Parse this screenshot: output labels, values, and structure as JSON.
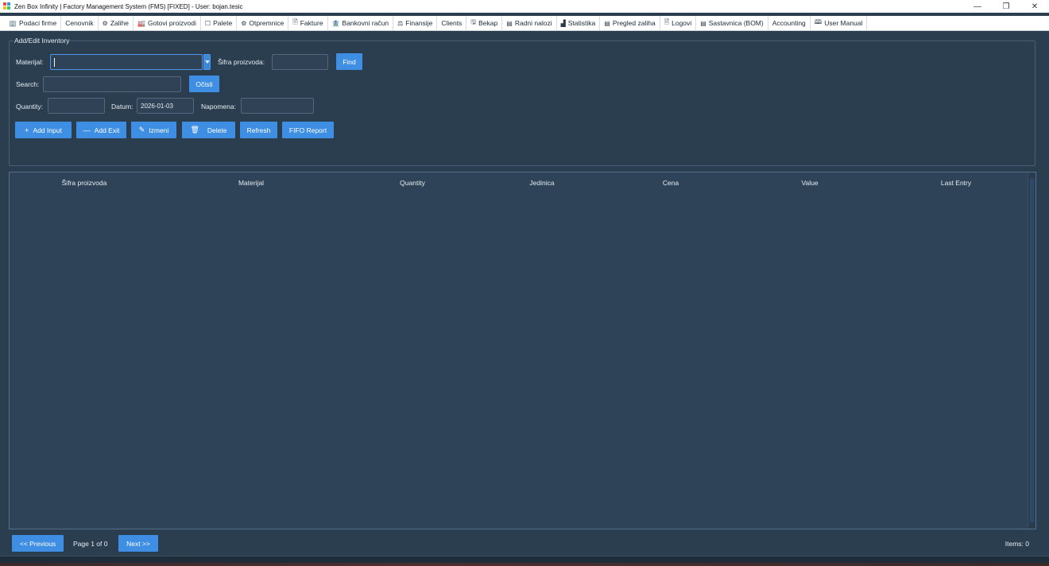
{
  "window": {
    "title": "Zen Box Infinity | Factory Management System (FMS) [FIXED] - User: bojan.tesic",
    "minimize": "—",
    "restore": "❐",
    "close": "✕"
  },
  "tabs": [
    {
      "icon": "🏢",
      "label": "Podaci firme"
    },
    {
      "icon": "",
      "label": "Cenovnik"
    },
    {
      "icon": "⚙",
      "label": "Zalihe"
    },
    {
      "icon": "🏭",
      "label": "Gotovi proizvodi"
    },
    {
      "icon": "☐",
      "label": "Palete"
    },
    {
      "icon": "⚙",
      "label": "Otpremnice"
    },
    {
      "icon": "🗎",
      "label": "Fakture"
    },
    {
      "icon": "🏦",
      "label": "Bankovni račun"
    },
    {
      "icon": "⚖",
      "label": "Finansije"
    },
    {
      "icon": "",
      "label": "Clients"
    },
    {
      "icon": "🖫",
      "label": "Bekap"
    },
    {
      "icon": "▤",
      "label": "Radni nalozi"
    },
    {
      "icon": "▟",
      "label": "Statistika"
    },
    {
      "icon": "▤",
      "label": "Pregled zaliha"
    },
    {
      "icon": "🗎",
      "label": "Logovi"
    },
    {
      "icon": "▤",
      "label": "Sastavnica (BOM)"
    },
    {
      "icon": "",
      "label": "Accounting"
    },
    {
      "icon": "🕮",
      "label": "User Manual"
    }
  ],
  "form": {
    "group_title": "Add/Edit Inventory",
    "material_label": "Materijal:",
    "material_value": "",
    "code_label": "Šifra proizvoda:",
    "code_value": "",
    "find_label": "Find",
    "search_label": "Search:",
    "search_value": "",
    "clear_label": "Očisti",
    "quantity_label": "Quantity:",
    "quantity_value": "",
    "date_label": "Datum:",
    "date_value": "2026-01-03",
    "note_label": "Napomena:",
    "note_value": ""
  },
  "actions": {
    "add_input_icon": "+",
    "add_input": "Add Input",
    "add_exit_icon": "—",
    "add_exit": "Add Exit",
    "edit_icon": "✎",
    "edit": "Izmeni",
    "delete_icon": "🗑",
    "delete": "Delete",
    "refresh": "Refresh",
    "fifo": "FIFO Report"
  },
  "table": {
    "columns": [
      "Šifra proizvoda",
      "Materijal",
      "Quantity",
      "Jedinica",
      "Cena",
      "Value",
      "Last Entry"
    ],
    "rows": []
  },
  "pagination": {
    "prev": "<< Previous",
    "info": "Page 1 of 0",
    "next": "Next >>",
    "items": "Items: 0"
  },
  "colors": {
    "background": "#2b3e50",
    "accent": "#3e8ee3",
    "panel": "#2e4358"
  }
}
